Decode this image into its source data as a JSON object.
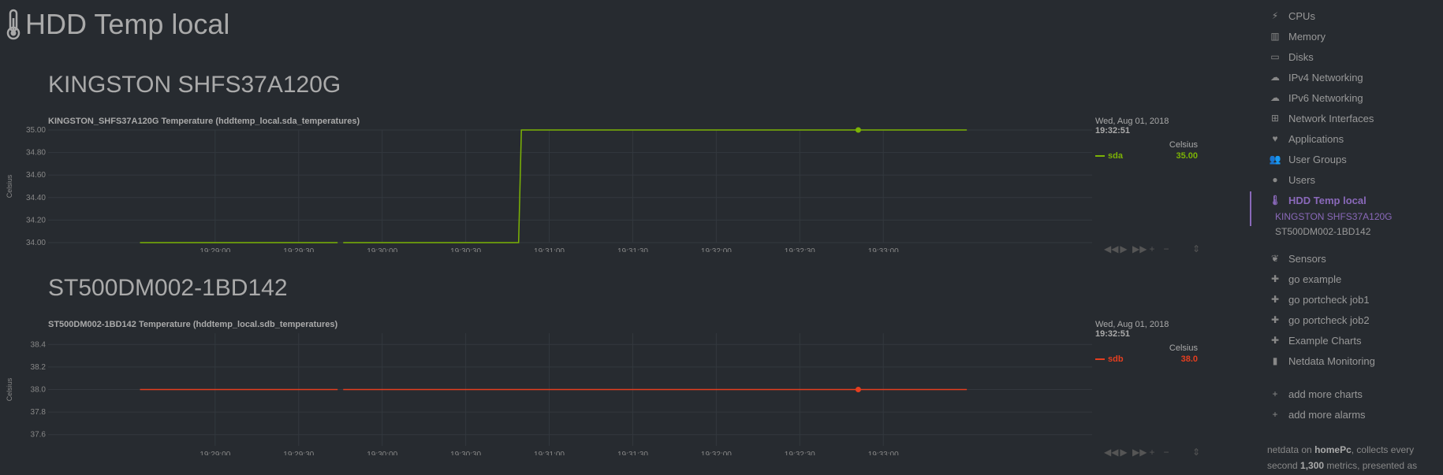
{
  "page": {
    "title": "HDD Temp local"
  },
  "sections": [
    {
      "title": "KINGSTON SHFS37A120G",
      "chart_title": "KINGSTON_SHFS37A120G Temperature (hddtemp_local.sda_temperatures)",
      "legend": {
        "date": "Wed, Aug 01, 2018",
        "time": "19:32:51",
        "unit": "Celsius",
        "series_name": "sda",
        "series_value": "35.00"
      }
    },
    {
      "title": "ST500DM002-1BD142",
      "chart_title": "ST500DM002-1BD142 Temperature (hddtemp_local.sdb_temperatures)",
      "legend": {
        "date": "Wed, Aug 01, 2018",
        "time": "19:32:51",
        "unit": "Celsius",
        "series_name": "sdb",
        "series_value": "38.0"
      }
    }
  ],
  "toolbar": {
    "icons": [
      "rewind-icon",
      "play-icon",
      "fast-forward-icon",
      "zoom-in-icon",
      "zoom-out-icon"
    ],
    "glyphs": [
      "◀◀",
      "▶",
      "▶▶",
      "+",
      "−"
    ],
    "resize_glyph": "⇕"
  },
  "chart_data": [
    {
      "type": "line",
      "title": "KINGSTON_SHFS37A120G Temperature (hddtemp_local.sda_temperatures)",
      "ylabel": "Celsius",
      "ylim": [
        34.0,
        35.0
      ],
      "yticks": [
        "35.00",
        "34.80",
        "34.60",
        "34.40",
        "34.20",
        "34.00"
      ],
      "xticks": [
        "19:29:00",
        "19:29:30",
        "19:30:00",
        "19:30:30",
        "19:31:00",
        "19:31:30",
        "19:32:00",
        "19:32:30",
        "19:33:00"
      ],
      "color": "#7cb305",
      "gap_at": "19:29:45",
      "series": [
        {
          "name": "sda",
          "x": [
            "19:28:33",
            "19:29:44",
            "19:29:46",
            "19:30:49",
            "19:30:50",
            "19:33:30"
          ],
          "values": [
            34.0,
            34.0,
            34.0,
            34.0,
            35.0,
            35.0
          ]
        }
      ],
      "hover": {
        "x": "19:32:51",
        "value": 35.0
      }
    },
    {
      "type": "line",
      "title": "ST500DM002-1BD142 Temperature (hddtemp_local.sdb_temperatures)",
      "ylabel": "Celsius",
      "ylim": [
        37.5,
        38.5
      ],
      "yticks": [
        "38.4",
        "38.2",
        "38.0",
        "37.8",
        "37.6"
      ],
      "xticks": [
        "19:29:00",
        "19:29:30",
        "19:30:00",
        "19:30:30",
        "19:31:00",
        "19:31:30",
        "19:32:00",
        "19:32:30",
        "19:33:00"
      ],
      "color": "#e53e1f",
      "gap_at": "19:29:45",
      "series": [
        {
          "name": "sdb",
          "x": [
            "19:28:33",
            "19:29:44",
            "19:29:46",
            "19:33:30"
          ],
          "values": [
            38.0,
            38.0,
            38.0,
            38.0
          ]
        }
      ],
      "hover": {
        "x": "19:32:51",
        "value": 38.0
      }
    }
  ],
  "sidebar": {
    "items": [
      {
        "label": "CPUs",
        "icon": "bolt-icon",
        "glyph": "⚡"
      },
      {
        "label": "Memory",
        "icon": "memory-icon",
        "glyph": "▥"
      },
      {
        "label": "Disks",
        "icon": "hdd-icon",
        "glyph": "▭"
      },
      {
        "label": "IPv4 Networking",
        "icon": "cloud-icon",
        "glyph": "☁"
      },
      {
        "label": "IPv6 Networking",
        "icon": "cloud-icon",
        "glyph": "☁"
      },
      {
        "label": "Network Interfaces",
        "icon": "sitemap-icon",
        "glyph": "⊞"
      },
      {
        "label": "Applications",
        "icon": "heartbeat-icon",
        "glyph": "♥"
      },
      {
        "label": "User Groups",
        "icon": "users-icon",
        "glyph": "👥"
      },
      {
        "label": "Users",
        "icon": "user-icon",
        "glyph": "●"
      },
      {
        "label": "HDD Temp local",
        "icon": "thermometer-icon",
        "glyph": "🌡",
        "active": true
      },
      {
        "label": "Sensors",
        "icon": "leaf-icon",
        "glyph": "❦"
      },
      {
        "label": "go example",
        "icon": "puzzle-icon",
        "glyph": "✚"
      },
      {
        "label": "go portcheck job1",
        "icon": "puzzle-icon",
        "glyph": "✚"
      },
      {
        "label": "go portcheck job2",
        "icon": "puzzle-icon",
        "glyph": "✚"
      },
      {
        "label": "Example Charts",
        "icon": "puzzle-icon",
        "glyph": "✚"
      },
      {
        "label": "Netdata Monitoring",
        "icon": "bar-chart-icon",
        "glyph": "▮"
      },
      {
        "label": "add more charts",
        "icon": "plus-icon",
        "glyph": "+"
      },
      {
        "label": "add more alarms",
        "icon": "plus-icon",
        "glyph": "+"
      }
    ],
    "subitems": [
      {
        "label": "KINGSTON SHFS37A120G",
        "active": true
      },
      {
        "label": "ST500DM002-1BD142",
        "active": false
      }
    ],
    "footer": {
      "prefix": "netdata on ",
      "host": "homePc",
      "mid": ", collects every second ",
      "metrics": "1,300",
      "suffix": " metrics, presented as"
    }
  }
}
